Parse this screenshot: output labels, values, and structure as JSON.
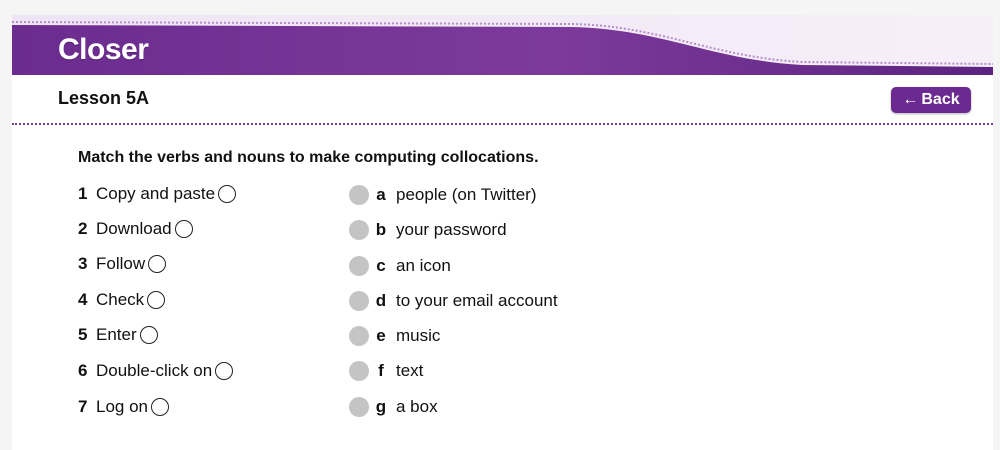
{
  "header": {
    "title": "Closer",
    "lesson": "Lesson 5A",
    "back_label": "Back",
    "colors": {
      "brand": "#6a2a8f",
      "dotted": "#7b3a9a"
    }
  },
  "instruction": "Match the verbs and nouns to make computing collocations.",
  "verbs": [
    {
      "num": "1",
      "text": "Copy and paste"
    },
    {
      "num": "2",
      "text": "Download"
    },
    {
      "num": "3",
      "text": "Follow"
    },
    {
      "num": "4",
      "text": "Check"
    },
    {
      "num": "5",
      "text": "Enter"
    },
    {
      "num": "6",
      "text": "Double-click on"
    },
    {
      "num": "7",
      "text": "Log on"
    }
  ],
  "nouns": [
    {
      "letter": "a",
      "text": "people (on Twitter)"
    },
    {
      "letter": "b",
      "text": "your password"
    },
    {
      "letter": "c",
      "text": "an icon"
    },
    {
      "letter": "d",
      "text": "to your email account"
    },
    {
      "letter": "e",
      "text": "music"
    },
    {
      "letter": "f",
      "text": "text"
    },
    {
      "letter": "g",
      "text": "a box"
    }
  ]
}
